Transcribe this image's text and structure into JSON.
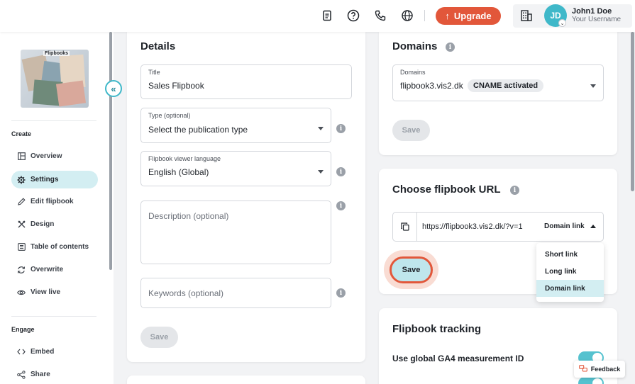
{
  "topbar": {
    "upgrade_label": "Upgrade",
    "user_initials": "JD",
    "user_name": "John1 Doe",
    "user_sub": "Your Username"
  },
  "sidebar": {
    "thumbnail_title": "Flipbooks",
    "sections": {
      "create": "Create",
      "engage": "Engage"
    },
    "items": [
      {
        "label": "Overview",
        "icon": "layout-icon"
      },
      {
        "label": "Settings",
        "icon": "gear-icon"
      },
      {
        "label": "Edit flipbook",
        "icon": "pencil-icon"
      },
      {
        "label": "Design",
        "icon": "design-tools-icon"
      },
      {
        "label": "Table of contents",
        "icon": "list-icon"
      },
      {
        "label": "Overwrite",
        "icon": "refresh-icon"
      },
      {
        "label": "View live",
        "icon": "eye-icon"
      },
      {
        "label": "Embed",
        "icon": "code-icon"
      },
      {
        "label": "Share",
        "icon": "share-icon"
      }
    ]
  },
  "details": {
    "title": "Details",
    "title_field": {
      "label": "Title",
      "value": "Sales Flipbook"
    },
    "type_field": {
      "label": "Type (optional)",
      "value": "Select the publication type"
    },
    "language_field": {
      "label": "Flipbook viewer language",
      "value": "English (Global)"
    },
    "description_placeholder": "Description (optional)",
    "keywords_placeholder": "Keywords (optional)",
    "save_label": "Save"
  },
  "domains": {
    "title": "Domains",
    "field_label": "Domains",
    "value": "flipbook3.vis2.dk",
    "badge": "CNAME activated",
    "save_label": "Save"
  },
  "flipbook_url": {
    "title": "Choose flipbook URL",
    "url": "https://flipbook3.vis2.dk/?v=1",
    "selected_type": "Domain link",
    "save_label": "Save",
    "options": [
      "Short link",
      "Long link",
      "Domain link"
    ]
  },
  "tracking": {
    "title": "Flipbook tracking",
    "rows": [
      {
        "label": "Use global GA4 measurement ID",
        "enabled": true
      }
    ]
  },
  "feedback_label": "Feedback",
  "colors": {
    "accent": "#3fb8c9",
    "upgrade": "#e2573a",
    "active_bg": "#d3eef2"
  }
}
